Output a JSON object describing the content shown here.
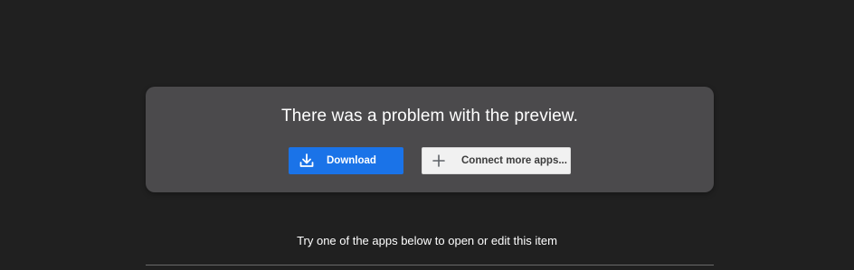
{
  "preview_error": {
    "title": "There was a problem with the preview.",
    "download_button": {
      "label": "Download",
      "icon": "download-icon"
    },
    "connect_button": {
      "label": "Connect more apps...",
      "icon": "plus-icon"
    }
  },
  "apps_section": {
    "hint": "Try one of the apps below to open or edit this item"
  },
  "colors": {
    "background": "#202020",
    "card": "#4b4a4c",
    "primary_button": "#1a73e8",
    "secondary_button": "#f1f1f1"
  }
}
